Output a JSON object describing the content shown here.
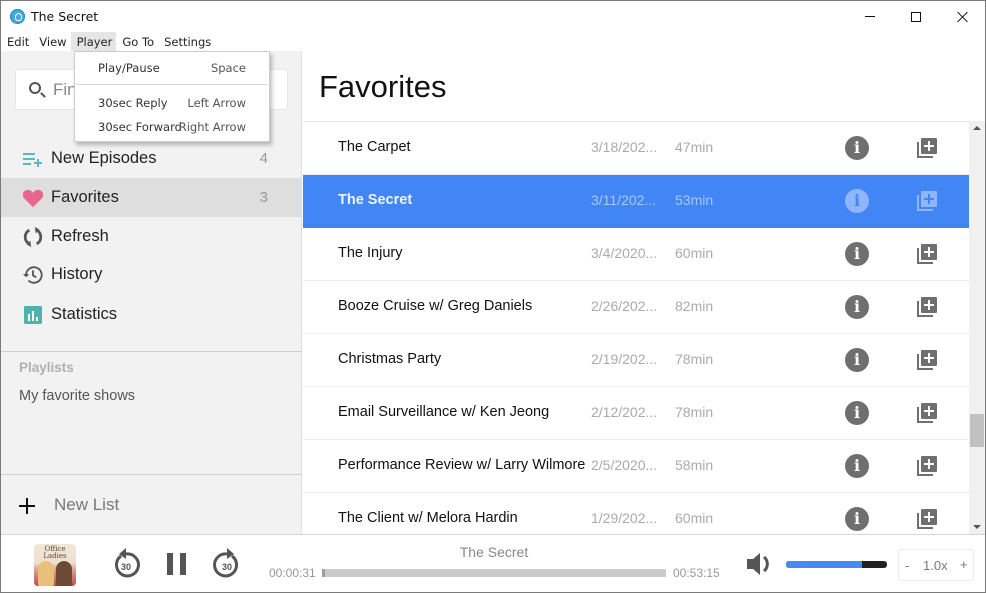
{
  "window": {
    "title": "The Secret",
    "controls": {
      "minimize": "minimize",
      "maximize": "maximize",
      "close": "close"
    }
  },
  "menubar": {
    "items": [
      "Edit",
      "View",
      "Player",
      "Go To",
      "Settings"
    ],
    "active": "Player"
  },
  "player_menu": {
    "items": [
      {
        "label": "Play/Pause",
        "shortcut": "Space"
      },
      {
        "label": "30sec Reply",
        "shortcut": "Left Arrow"
      },
      {
        "label": "30sec Forward",
        "shortcut": "Right Arrow"
      }
    ]
  },
  "sidebar": {
    "search": {
      "placeholder": "Find",
      "value": ""
    },
    "nav": [
      {
        "label": "New Episodes",
        "count": "4",
        "icon": "playlist-add-icon",
        "color": "#5bb8c9"
      },
      {
        "label": "Favorites",
        "count": "3",
        "icon": "heart-icon",
        "color": "#e9678e",
        "selected": true
      },
      {
        "label": "Refresh",
        "count": "",
        "icon": "refresh-icon",
        "color": "#555555"
      },
      {
        "label": "History",
        "count": "",
        "icon": "history-icon",
        "color": "#555555"
      },
      {
        "label": "Statistics",
        "count": "",
        "icon": "statistics-icon",
        "color": "#4db3ac"
      }
    ],
    "playlists_header": "Playlists",
    "playlists": [
      "My favorite shows"
    ],
    "new_list_label": "New List"
  },
  "main": {
    "title": "Favorites",
    "episodes": [
      {
        "title": "The Carpet",
        "date": "3/18/202...",
        "duration": "47min"
      },
      {
        "title": "The Secret",
        "date": "3/11/202...",
        "duration": "53min",
        "selected": true
      },
      {
        "title": "The Injury",
        "date": "3/4/2020...",
        "duration": "60min"
      },
      {
        "title": "Booze Cruise w/ Greg Daniels",
        "date": "2/26/202...",
        "duration": "82min"
      },
      {
        "title": "Christmas Party",
        "date": "2/19/202...",
        "duration": "78min"
      },
      {
        "title": "Email Surveillance w/ Ken Jeong",
        "date": "2/12/202...",
        "duration": "78min"
      },
      {
        "title": "Performance Review w/ Larry Wilmore",
        "date": "2/5/2020...",
        "duration": "58min"
      },
      {
        "title": "The Client w/ Melora Hardin",
        "date": "1/29/202...",
        "duration": "60min"
      }
    ],
    "scroll_position_fraction": 0.72
  },
  "player": {
    "cover_text": "Office Ladies",
    "now_playing": "The Secret",
    "time_current": "00:00:31",
    "time_total": "00:53:15",
    "progress_fraction": 0.0097,
    "skip_seconds": "30",
    "volume_fraction": 0.75,
    "speed": "1.0x",
    "speed_minus": "-",
    "speed_plus": "+",
    "accent_color": "#4285f4"
  }
}
